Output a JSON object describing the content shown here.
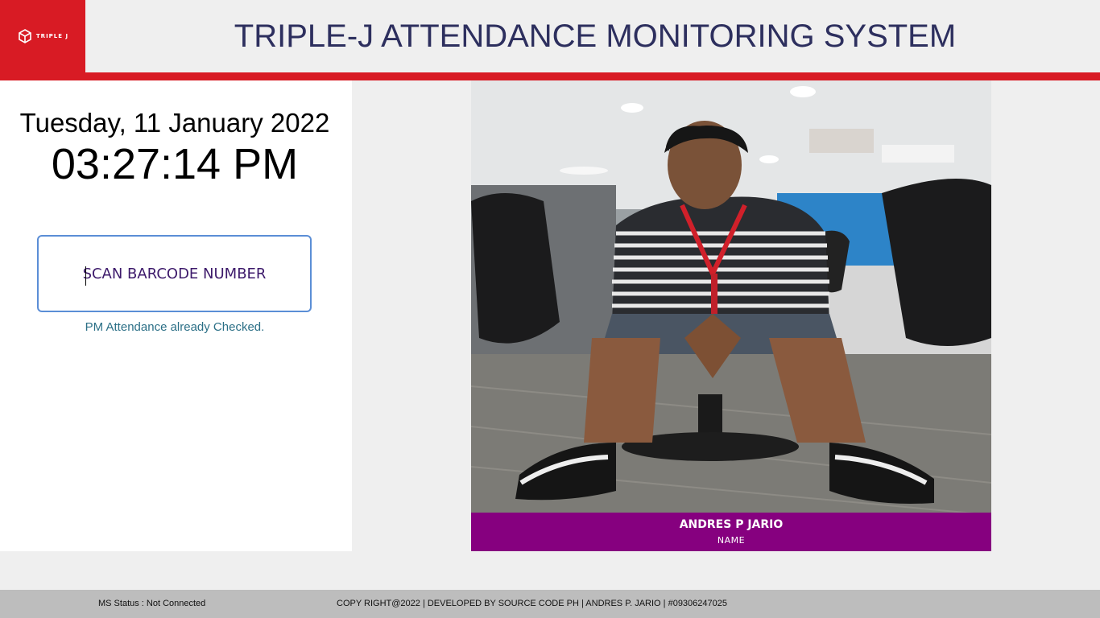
{
  "header": {
    "logo_text": "TRIPLE J",
    "title": "TRIPLE-J ATTENDANCE MONITORING SYSTEM"
  },
  "clock": {
    "date": "Tuesday, 11 January 2022",
    "time": "03:27:14 PM"
  },
  "scanner": {
    "placeholder": "SCAN BARCODE NUMBER",
    "value": "",
    "status_message": "PM Attendance already Checked."
  },
  "employee": {
    "name": "ANDRES P JARIO",
    "name_label": "NAME"
  },
  "footer": {
    "ms_status": "MS Status : Not Connected",
    "copyright": "COPY RIGHT@2022 | DEVELOPED BY SOURCE CODE PH | ANDRES P. JARIO | #09306247025"
  },
  "colors": {
    "brand_red": "#d81b24",
    "title_navy": "#2d2f5e",
    "name_bar_purple": "#86007f",
    "status_teal": "#2b6f86",
    "input_border_blue": "#5b8ed6"
  },
  "icons": {
    "logo": "cube-logo-icon"
  }
}
